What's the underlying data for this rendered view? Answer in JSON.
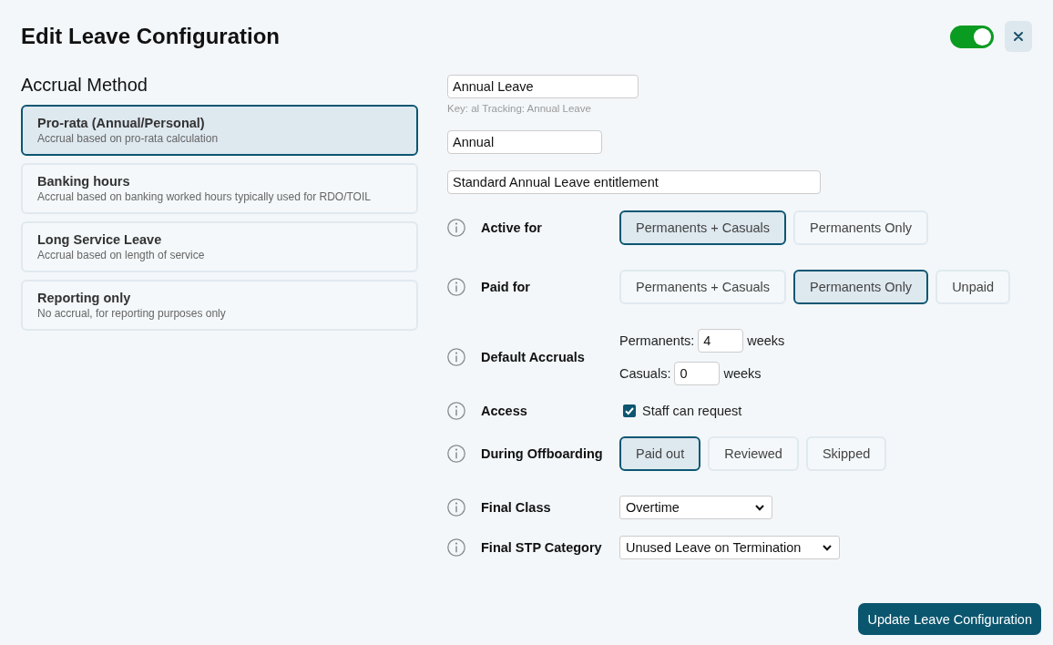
{
  "dialog": {
    "title": "Edit Leave Configuration",
    "enabled": true
  },
  "accrual_method": {
    "heading": "Accrual Method",
    "options": [
      {
        "title": "Pro-rata (Annual/Personal)",
        "description": "Accrual based on pro-rata calculation",
        "selected": true
      },
      {
        "title": "Banking hours",
        "description": "Accrual based on banking worked hours typically used for RDO/TOIL",
        "selected": false
      },
      {
        "title": "Long Service Leave",
        "description": "Accrual based on length of service",
        "selected": false
      },
      {
        "title": "Reporting only",
        "description": "No accrual, for reporting purposes only",
        "selected": false
      }
    ]
  },
  "details": {
    "name": "Annual Leave",
    "hint": "Key: al Tracking: Annual Leave",
    "code": "Annual",
    "description": "Standard Annual Leave entitlement"
  },
  "settings": [
    {
      "kind": "choice",
      "label": "Active for",
      "options": [
        {
          "label": "Permanents + Casuals",
          "selected": true
        },
        {
          "label": "Permanents Only",
          "selected": false
        }
      ]
    },
    {
      "kind": "choice",
      "label": "Paid for",
      "options": [
        {
          "label": "Permanents + Casuals",
          "selected": false
        },
        {
          "label": "Permanents Only",
          "selected": true
        },
        {
          "label": "Unpaid",
          "selected": false
        }
      ]
    },
    {
      "kind": "amounts",
      "label": "Default Accruals",
      "fields": [
        {
          "label": "Permanents:",
          "value": "4",
          "unit": "weeks"
        },
        {
          "label": "Casuals:",
          "value": "0",
          "unit": "weeks"
        }
      ]
    },
    {
      "kind": "checkbox",
      "label": "Access",
      "option": {
        "label": "Staff can request",
        "checked": true
      }
    },
    {
      "kind": "choice",
      "label": "During Offboarding",
      "options": [
        {
          "label": "Paid out",
          "selected": true
        },
        {
          "label": "Reviewed",
          "selected": false
        },
        {
          "label": "Skipped",
          "selected": false
        }
      ]
    },
    {
      "kind": "select",
      "label": "Final Class",
      "value": "Overtime"
    },
    {
      "kind": "select",
      "label": "Final STP Category",
      "value": "Unused Leave on Termination"
    }
  ],
  "submit": {
    "label": "Update Leave Configuration"
  }
}
